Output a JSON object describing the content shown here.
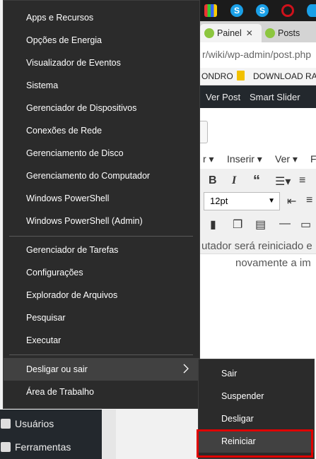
{
  "menu": {
    "items_group1": [
      "Apps e Recursos",
      "Opções de Energia",
      "Visualizador de Eventos",
      "Sistema",
      "Gerenciador de Dispositivos",
      "Conexões de Rede",
      "Gerenciamento de Disco",
      "Gerenciamento do Computador",
      "Windows PowerShell",
      "Windows PowerShell (Admin)"
    ],
    "items_group2": [
      "Gerenciador de Tarefas",
      "Configurações",
      "Explorador de Arquivos",
      "Pesquisar",
      "Executar"
    ],
    "shutdown_label": "Desligar ou sair",
    "desktop_label": "Área de Trabalho"
  },
  "submenu": {
    "items": [
      "Sair",
      "Suspender",
      "Desligar",
      "Reiniciar"
    ],
    "highlighted": "Reiniciar"
  },
  "browser": {
    "tabs": [
      {
        "label": "Painel"
      },
      {
        "label": "Posts"
      }
    ],
    "url_fragment": "r/wiki/wp-admin/post.php",
    "bookmarks": [
      "ONDRO",
      "DOWNLOAD RAP"
    ]
  },
  "wp_admin_bar": {
    "items": [
      "Ver Post",
      "Smart Slider"
    ]
  },
  "editor": {
    "menu": [
      "r ▾",
      "Inserir ▾",
      "Ver ▾",
      "F"
    ],
    "font_size": "12pt",
    "content_line1": "utador será reiniciado e",
    "content_line2": "novamente a im"
  },
  "wp_sidebar": {
    "items": [
      "Usuários",
      "Ferramentas"
    ]
  },
  "colors": {
    "menu_bg": "#2b2b2b",
    "menu_highlight": "#414141",
    "highlight_box": "#e00000",
    "wp_dark": "#23282d"
  }
}
